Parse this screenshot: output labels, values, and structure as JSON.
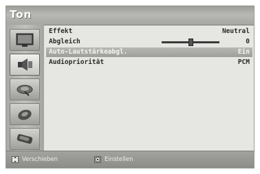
{
  "title": "Ton",
  "sidebar": {
    "items": [
      {
        "icon": "tv-picture-icon",
        "active": false
      },
      {
        "icon": "speaker-icon",
        "active": true
      },
      {
        "icon": "satellite-dish-icon",
        "active": false
      },
      {
        "icon": "setup-icon",
        "active": false
      },
      {
        "icon": "input-icon",
        "active": false
      }
    ]
  },
  "menu": {
    "rows": [
      {
        "label": "Effekt",
        "value": "Neutral"
      },
      {
        "label": "Abgleich",
        "value": "0"
      },
      {
        "label": "Auto-Lautstärkeabgl.",
        "value": "Ein"
      },
      {
        "label": "Audiopriorität",
        "value": "PCM"
      }
    ],
    "balance_level": 0.5
  },
  "footer": {
    "move_label": "Verschieben",
    "enter_label": "Einstellen"
  }
}
